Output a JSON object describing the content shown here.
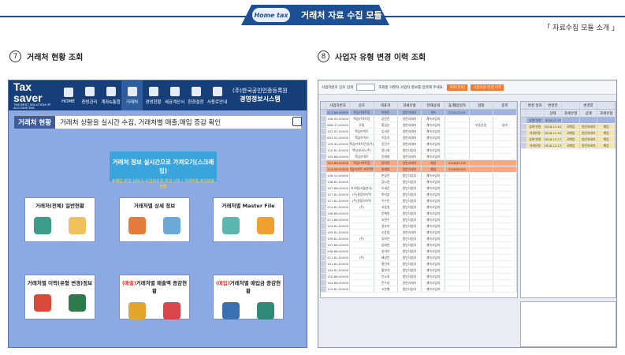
{
  "banner": {
    "logo": "Home tax",
    "title": "거래처 자료 수집 모듈"
  },
  "intro_link": "「 자료수집 모듈 소개 」",
  "section1": {
    "num": "7",
    "title": "거래처 현황 조회"
  },
  "section2": {
    "num": "8",
    "title": "사업자 유형 변경 이력 조회"
  },
  "left_app": {
    "logo": "Tax saver",
    "logo_tag": "THE BEST SOLUTION OF ACCOUNTING",
    "menu": [
      "HOME",
      "증빙관리",
      "계좌&통합",
      "거래처",
      "경영현황",
      "세금계산서",
      "환경설정",
      "사용로안내"
    ],
    "active_menu": 3,
    "company_line1": "(주)한국공인인증등록원",
    "company_line2": "경영정보시스템",
    "subbar_label": "거래처 현황",
    "subbar_text": "거래처 상황을 실시간 수집, 거래처별 매출,매입 증감 확인",
    "cta_title": "거래처 정보 실시간으로 가져오기(스크래핑)",
    "cta_sub": "휴폐업 변경 상태 & 사업자유형 변경 사항 / 거래처별 매입매출 현황",
    "cards": [
      {
        "pre": "",
        "red": "",
        "post": "거래처(전체) 일반현황"
      },
      {
        "pre": "",
        "red": "",
        "post": "거래처별 상세 정보"
      },
      {
        "pre": "",
        "red": "",
        "post": "거래처별 Master File"
      },
      {
        "pre": "거래처별 이력(유형 변경)정보",
        "red": "",
        "post": ""
      },
      {
        "pre": "",
        "red": "(매출)",
        "post": "거래처별 매출액 증감현황"
      },
      {
        "pre": "",
        "red": "(매입)",
        "post": "거래처별 매입금 증감현황"
      }
    ]
  },
  "right_app": {
    "filter_label": "사업자번호 상호 검색",
    "filter_hint": "조회할 거래처 사업자 정보를 입력해 주세요.",
    "btn1": "조회(전체)",
    "btn2": "사업유형 변경 이력",
    "main_headers": [
      "사업자번호",
      "상호",
      "대표자",
      "과세유형",
      "현재상태",
      "휴/폐업일자",
      "업태",
      "종목"
    ],
    "main_rows": [
      {
        "cls": "sel",
        "c": [
          "211-86-90000",
          "핵심커넥트팀",
          "박현돈",
          "일반과세자",
          "계속",
          "2018/12/31",
          "",
          ""
        ]
      },
      {
        "cls": "",
        "c": [
          "106-05-00000",
          "핵심커넥트팀",
          "김민진",
          "일반과세자",
          "계속사업자",
          "",
          "",
          ""
        ]
      },
      {
        "cls": "",
        "c": [
          "608-17-00000",
          "유통",
          "홍길순",
          "일반과세자",
          "계속사업자",
          "",
          "부동산업",
          "임대"
        ]
      },
      {
        "cls": "",
        "c": [
          "107-07-00000",
          "핵심커넥트",
          "김서윤",
          "일반과세자",
          "계속사업자",
          "",
          "",
          ""
        ]
      },
      {
        "cls": "",
        "c": [
          "603-52-00000",
          "핵심아이티",
          "이동욱",
          "일반과세자",
          "계속사업자",
          "",
          "",
          ""
        ]
      },
      {
        "cls": "",
        "c": [
          "129-54-00000",
          "핵심커넥트운영(주)",
          "강진우",
          "일반과세자",
          "계속사업자",
          "",
          "",
          ""
        ]
      },
      {
        "cls": "",
        "c": [
          "120-81-00000",
          "핵심서비스(주)",
          "정나래",
          "법인사업자",
          "계속사업자",
          "",
          "",
          ""
        ]
      },
      {
        "cls": "",
        "c": [
          "105-88-00000",
          "핵심커넥트",
          "윤재형",
          "일반과세자",
          "계속사업자",
          "",
          "",
          ""
        ]
      },
      {
        "cls": "hl",
        "c": [
          "104-86-00000",
          "핵심커넥트팀",
          "장미연",
          "일반과세자",
          "폐업",
          "2018/07/18",
          "",
          ""
        ]
      },
      {
        "cls": "hl",
        "c": [
          "114-06-00000",
          "핵심커넥트 프로젝트",
          "최재원",
          "일반과세자",
          "폐업",
          "2018/09/04",
          "",
          ""
        ]
      },
      {
        "cls": "",
        "c": [
          "106-10-00000",
          "",
          "한상민",
          "법인사업자",
          "계속사업자",
          "",
          "",
          ""
        ]
      },
      {
        "cls": "",
        "c": [
          "108-81-00000",
          "",
          "김나연",
          "법인사업자",
          "계속사업자",
          "",
          "",
          ""
        ]
      },
      {
        "cls": "",
        "c": [
          "107-86-00000",
          "아이템(서울본사)",
          "오세진",
          "법인사업자",
          "계속사업자",
          "",
          "",
          ""
        ]
      },
      {
        "cls": "",
        "c": [
          "127-81-00000",
          "(주)종합하이텍",
          "박지훈",
          "법인사업자",
          "계속사업자",
          "",
          "",
          ""
        ]
      },
      {
        "cls": "",
        "c": [
          "127-81-00000",
          "(주)종합하이텍",
          "이수민",
          "법인사업자",
          "계속사업자",
          "",
          "",
          ""
        ]
      },
      {
        "cls": "",
        "c": [
          "214-81-00000",
          "(주)",
          "서동원",
          "법인사업자",
          "계속사업자",
          "",
          "",
          ""
        ]
      },
      {
        "cls": "",
        "c": [
          "106-86-00000",
          "",
          "문채원",
          "법인사업자",
          "계속사업자",
          "",
          "",
          ""
        ]
      },
      {
        "cls": "",
        "c": [
          "211-86-00000",
          "",
          "조현우",
          "법인사업자",
          "계속사업자",
          "",
          "",
          ""
        ]
      },
      {
        "cls": "",
        "c": [
          "124-81-00000",
          "",
          "권유리",
          "법인사업자",
          "계속사업자",
          "",
          "",
          ""
        ]
      },
      {
        "cls": "",
        "c": [
          "105-81-00000",
          "",
          "신동엽",
          "일반과세자",
          "계속사업자",
          "",
          "",
          ""
        ]
      },
      {
        "cls": "",
        "c": [
          "109-81-00000",
          "(주)",
          "류하은",
          "법인사업자",
          "계속사업자",
          "",
          "",
          ""
        ]
      },
      {
        "cls": "",
        "c": [
          "107-86-00000",
          "",
          "임태현",
          "법인사업자",
          "계속사업자",
          "",
          "",
          ""
        ]
      },
      {
        "cls": "",
        "c": [
          "206-86-00000",
          "",
          "송지아",
          "법인사업자",
          "계속사업자",
          "",
          "",
          ""
        ]
      },
      {
        "cls": "",
        "c": [
          "211-81-00000",
          "(주)",
          "배성민",
          "법인사업자",
          "계속사업자",
          "",
          "",
          ""
        ]
      },
      {
        "cls": "",
        "c": [
          "101-81-00000",
          "",
          "홍민지",
          "법인사업자",
          "계속사업자",
          "",
          "",
          ""
        ]
      },
      {
        "cls": "",
        "c": [
          "104-81-00000",
          "",
          "황보석",
          "법인사업자",
          "계속사업자",
          "",
          "",
          ""
        ]
      },
      {
        "cls": "",
        "c": [
          "120-86-00000",
          "",
          "안소희",
          "법인사업자",
          "계속사업자",
          "",
          "",
          ""
        ]
      },
      {
        "cls": "",
        "c": [
          "104-86-00000",
          "",
          "전우성",
          "일반과세자",
          "계속사업자",
          "",
          "",
          ""
        ]
      },
      {
        "cls": "",
        "c": [
          "119-81-00000",
          "",
          "고은별",
          "법인사업자",
          "계속사업자",
          "",
          "",
          ""
        ]
      }
    ],
    "hist_headers": [
      "변경 일자",
      "변경전",
      "",
      "변경후",
      ""
    ],
    "hist_sub": [
      "",
      "상태",
      "과세유형",
      "상태",
      "과세유형"
    ],
    "hist_rows": [
      {
        "cls": "sel",
        "c": [
          "유형 변경",
          "2018-12-01",
          "",
          "",
          ""
        ]
      },
      {
        "cls": "y",
        "c": [
          "상태 변경",
          "2018-12-01",
          "국폐업",
          "일반과세자",
          "폐업"
        ]
      },
      {
        "cls": "y",
        "c": [
          "과세유형",
          "2018-12-01",
          "국폐업",
          "일반과세자",
          "폐업"
        ]
      },
      {
        "cls": "y",
        "c": [
          "상태 변경",
          "2018-12-17",
          "국폐업",
          "일반과세자",
          "폐업"
        ]
      },
      {
        "cls": "y",
        "c": [
          "과세유형",
          "2018-12-17",
          "국폐업",
          "일반과세자",
          "폐업"
        ]
      }
    ]
  }
}
